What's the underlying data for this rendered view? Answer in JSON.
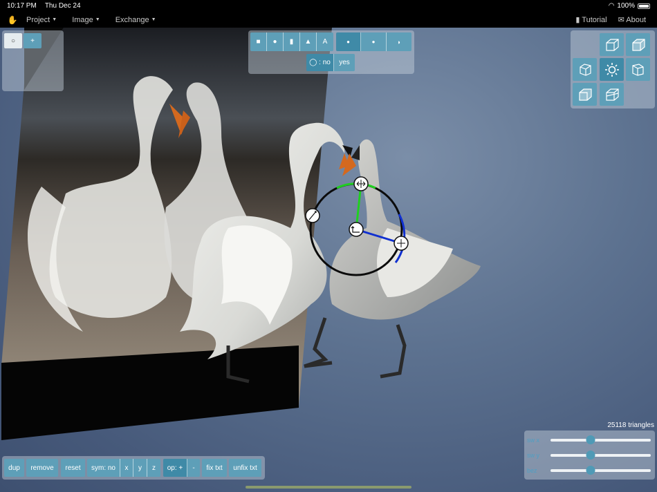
{
  "status": {
    "time": "10:17 PM",
    "date": "Thu Dec 24",
    "battery": "100%"
  },
  "menu": {
    "items": [
      "Project",
      "Image",
      "Exchange"
    ],
    "tutorial": "Tutorial",
    "about": "About"
  },
  "toolbar_top": {
    "shape_buttons": [
      "■",
      "●",
      "▮",
      "▲",
      "A"
    ],
    "mode_buttons": [
      "●",
      "●",
      "◗"
    ],
    "toggle_label": "◯ : no",
    "toggle_yes": "yes"
  },
  "left_panel": {
    "buttons": [
      "○",
      "+"
    ]
  },
  "view_panel": {
    "center_icon": "sun-icon"
  },
  "info": {
    "triangles": "25118 triangles"
  },
  "sliders": [
    {
      "label": "sw x",
      "value": 0.4
    },
    {
      "label": "sw y",
      "value": 0.4
    },
    {
      "label": "bez",
      "value": 0.4
    }
  ],
  "bottom_toolbar": {
    "dup": "dup",
    "remove": "remove",
    "reset": "reset",
    "sym": "sym: no",
    "x": "x",
    "y": "y",
    "z": "z",
    "op": "op: +",
    "minus": "-",
    "fix": "fix txt",
    "unfix": "unfix txt"
  }
}
